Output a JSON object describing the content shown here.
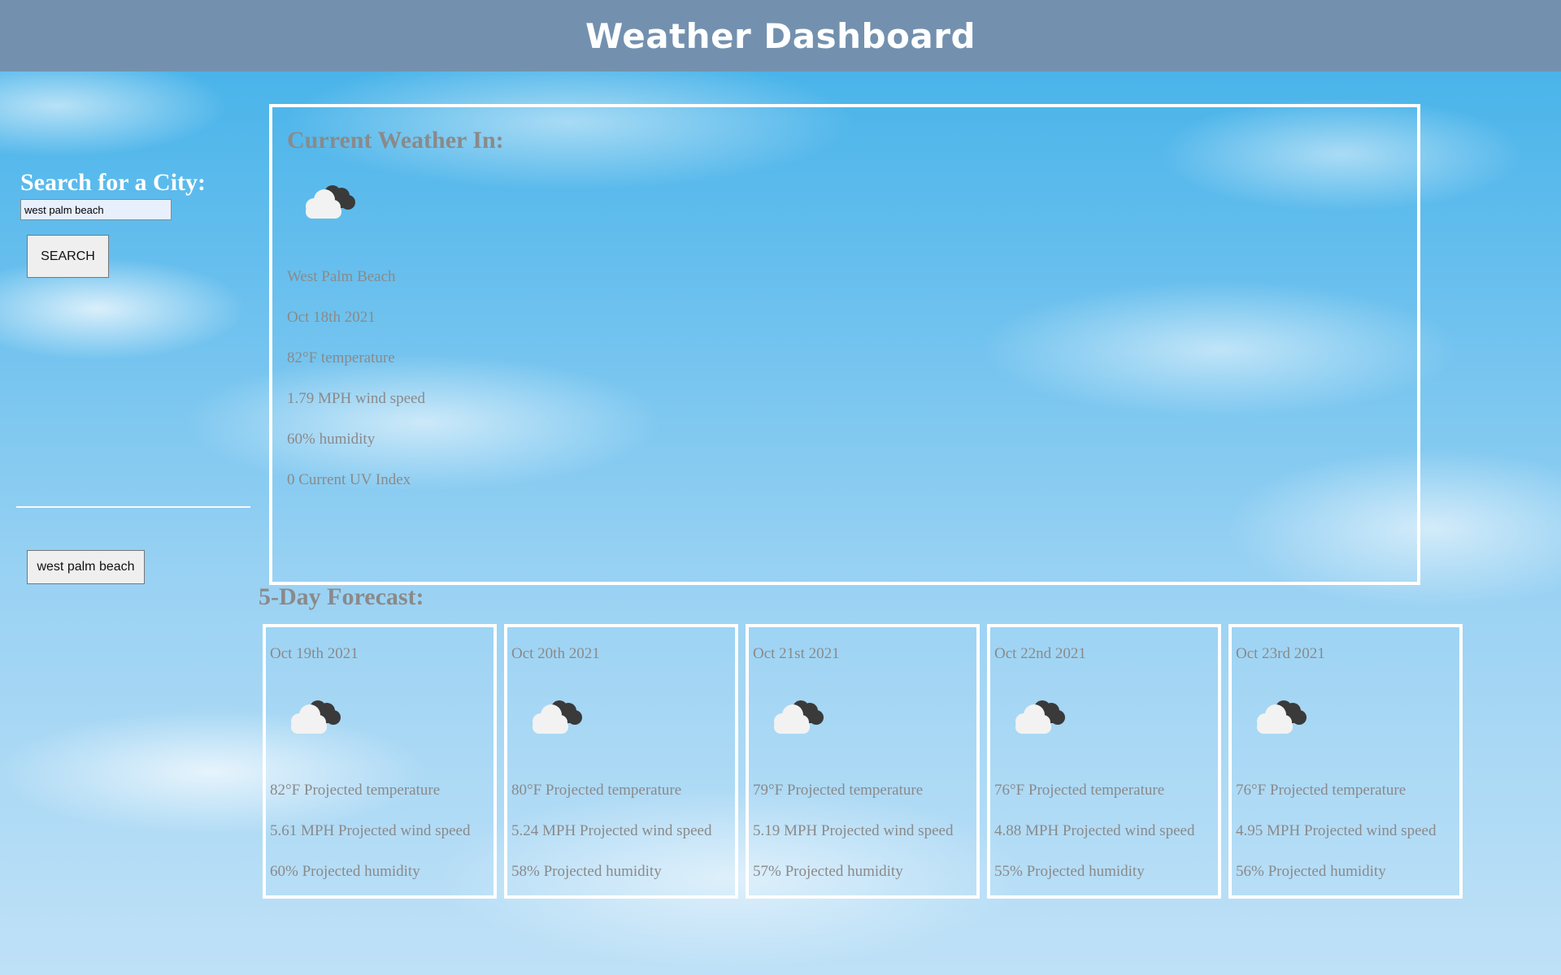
{
  "header": {
    "title": "Weather Dashboard"
  },
  "search": {
    "label": "Search for a City:",
    "input_value": "west palm beach",
    "button_label": "SEARCH"
  },
  "history": {
    "items": [
      {
        "label": "west palm beach"
      }
    ]
  },
  "current": {
    "heading": "Current Weather In:",
    "icon": "broken-clouds-icon",
    "city": "West Palm Beach",
    "date": "Oct 18th 2021",
    "temperature": "82°F temperature",
    "wind": "1.79 MPH wind speed",
    "humidity": "60% humidity",
    "uv": "0 Current UV Index"
  },
  "forecast": {
    "title": "5-Day Forecast:",
    "days": [
      {
        "date": "Oct 19th 2021",
        "icon": "broken-clouds-icon",
        "temp": "82°F Projected temperature",
        "wind": "5.61 MPH Projected wind speed",
        "humidity": "60% Projected humidity"
      },
      {
        "date": "Oct 20th 2021",
        "icon": "broken-clouds-icon",
        "temp": "80°F Projected temperature",
        "wind": "5.24 MPH Projected wind speed",
        "humidity": "58% Projected humidity"
      },
      {
        "date": "Oct 21st 2021",
        "icon": "broken-clouds-icon",
        "temp": "79°F Projected temperature",
        "wind": "5.19 MPH Projected wind speed",
        "humidity": "57% Projected humidity"
      },
      {
        "date": "Oct 22nd 2021",
        "icon": "broken-clouds-icon",
        "temp": "76°F Projected temperature",
        "wind": "4.88 MPH Projected wind speed",
        "humidity": "55% Projected humidity"
      },
      {
        "date": "Oct 23rd 2021",
        "icon": "broken-clouds-icon",
        "temp": "76°F Projected temperature",
        "wind": "4.95 MPH Projected wind speed",
        "humidity": "56% Projected humidity"
      }
    ]
  },
  "colors": {
    "header_bg": "#7391af",
    "text_gray": "#8a8a8a",
    "panel_border": "#ffffff"
  }
}
